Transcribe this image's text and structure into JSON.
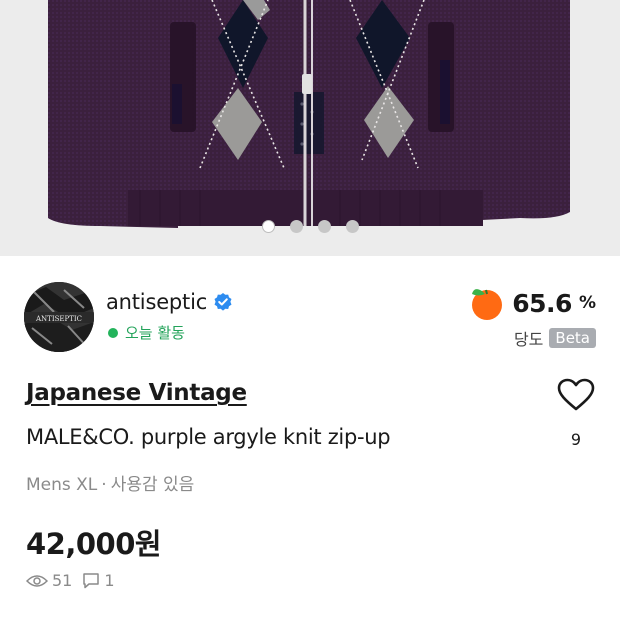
{
  "carousel": {
    "total": 4,
    "active_index": 0
  },
  "seller": {
    "name": "antiseptic",
    "verified": true,
    "status": "오늘 활동",
    "avatar_text": "ANTISEPTIC"
  },
  "sweetness": {
    "value": "65.6",
    "unit": "%",
    "label": "당도",
    "badge": "Beta"
  },
  "listing": {
    "category": "Japanese Vintage",
    "title": "MALE&CO. purple argyle knit zip-up",
    "size": "Mens XL",
    "condition": "사용감 있음",
    "price": "42,000원",
    "likes": "9",
    "views": "51",
    "comments": "1"
  },
  "colors": {
    "knit_purple": "#3a1f3c",
    "status_green": "#23a35a",
    "verified_blue": "#2d8cf0",
    "tangerine": "#ff6a13"
  },
  "icons": [
    "verified-check-icon",
    "tangerine-icon",
    "heart-icon",
    "eye-icon",
    "chat-bubble-icon"
  ]
}
